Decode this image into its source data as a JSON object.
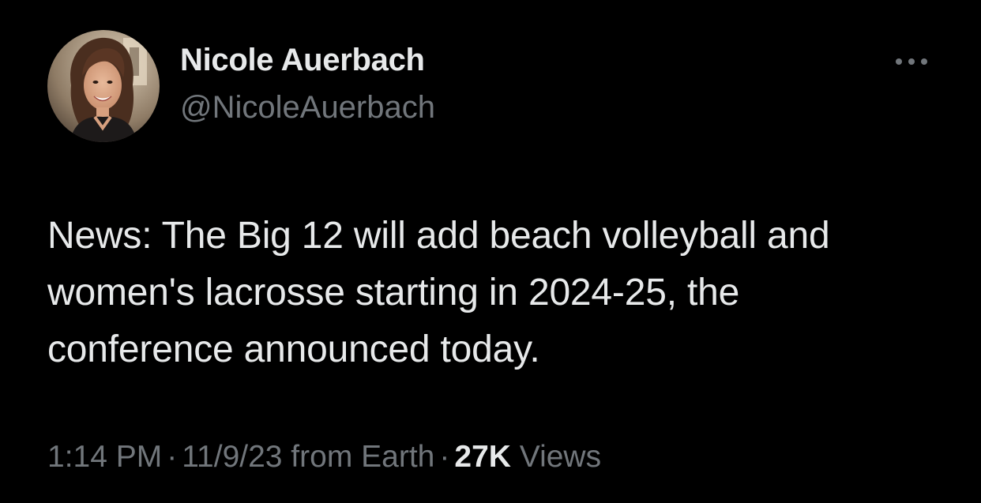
{
  "author": {
    "display_name": "Nicole Auerbach",
    "handle": "@NicoleAuerbach",
    "avatar_icon": "profile-photo"
  },
  "menu": {
    "more_icon": "more-horizontal-icon"
  },
  "tweet": {
    "text_lines": [
      "News: The Big 12 will add beach volleyball and",
      "women's lacrosse starting in 2024-25, the",
      "conference announced today."
    ]
  },
  "meta": {
    "time": "1:14 PM",
    "separator": "·",
    "date_source": "11/9/23 from Earth",
    "views_count": "27K",
    "views_label": "Views"
  },
  "colors": {
    "background": "#000000",
    "primary_text": "#e7e9ea",
    "secondary_text": "#71767b"
  }
}
